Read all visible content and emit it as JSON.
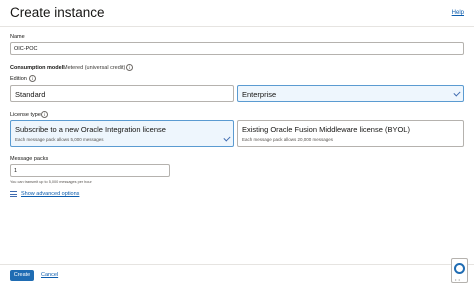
{
  "header": {
    "title": "Create instance",
    "help_label": "Help"
  },
  "name": {
    "label": "Name",
    "value": "OIC-POC"
  },
  "consumption": {
    "label": "Consumption model:",
    "value": "Metered (universal credit)"
  },
  "edition": {
    "label": "Edition",
    "options": [
      {
        "label": "Standard",
        "selected": false
      },
      {
        "label": "Enterprise",
        "selected": true
      }
    ]
  },
  "license": {
    "label": "License type",
    "options": [
      {
        "title": "Subscribe to a new Oracle Integration license",
        "subtitle": "Each message pack allows 5,000 messages",
        "selected": true
      },
      {
        "title": "Existing Oracle Fusion Middleware license (BYOL)",
        "subtitle": "Each message pack allows 20,000 messages",
        "selected": false
      }
    ]
  },
  "message_packs": {
    "label": "Message packs",
    "value": "1",
    "hint": "You can transmit up to 5,000 messages per hour"
  },
  "advanced": {
    "label": "Show advanced options"
  },
  "footer": {
    "create_label": "Create",
    "cancel_label": "Cancel"
  },
  "colors": {
    "accent": "#1f6cb3",
    "link": "#0b5cad",
    "selected_bg": "#eef6fd",
    "selected_border": "#5b9bd1"
  },
  "icons": [
    "info-icon",
    "check-icon",
    "advanced-options-icon",
    "help-assist-icon"
  ]
}
